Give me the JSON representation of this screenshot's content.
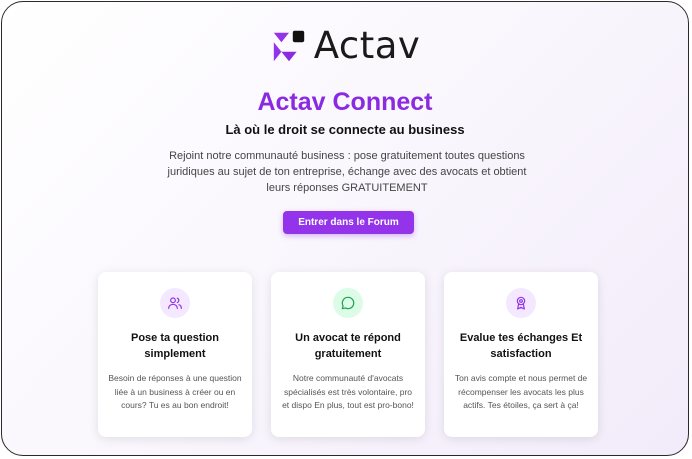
{
  "logo": {
    "text": "Actav"
  },
  "hero": {
    "title": "Actav Connect",
    "subtitle": "Là où le droit se connecte au business",
    "description": "Rejoint notre communauté business : pose gratuitement toutes questions juridiques au sujet de ton entreprise, échange avec des avocats et obtient leurs réponses GRATUITEMENT",
    "cta_label": "Entrer dans le Forum"
  },
  "colors": {
    "accent": "#9333ea",
    "title": "#8a2be2",
    "icon_purple_bg": "#f3e8ff",
    "icon_green_bg": "#dcfce7",
    "icon_green": "#16a34a"
  },
  "features": [
    {
      "icon": "users-icon",
      "title_line1": "Pose ta question",
      "title_line2": "simplement",
      "text": "Besoin de réponses à une question liée à un business à créer ou en cours? Tu es au bon endroit!"
    },
    {
      "icon": "chat-bubble-icon",
      "title_line1": "Un avocat te répond",
      "title_line2": "gratuitement",
      "text": "Notre communauté d'avocats spécialisés est très volontaire, pro et dispo En plus, tout est pro-bono!"
    },
    {
      "icon": "award-icon",
      "title_line1": "Evalue tes échanges Et",
      "title_line2": "satisfaction",
      "text": "Ton avis compte et nous permet de récompenser les avocats les plus actifs. Tes étoiles, ça sert à ça!"
    }
  ]
}
